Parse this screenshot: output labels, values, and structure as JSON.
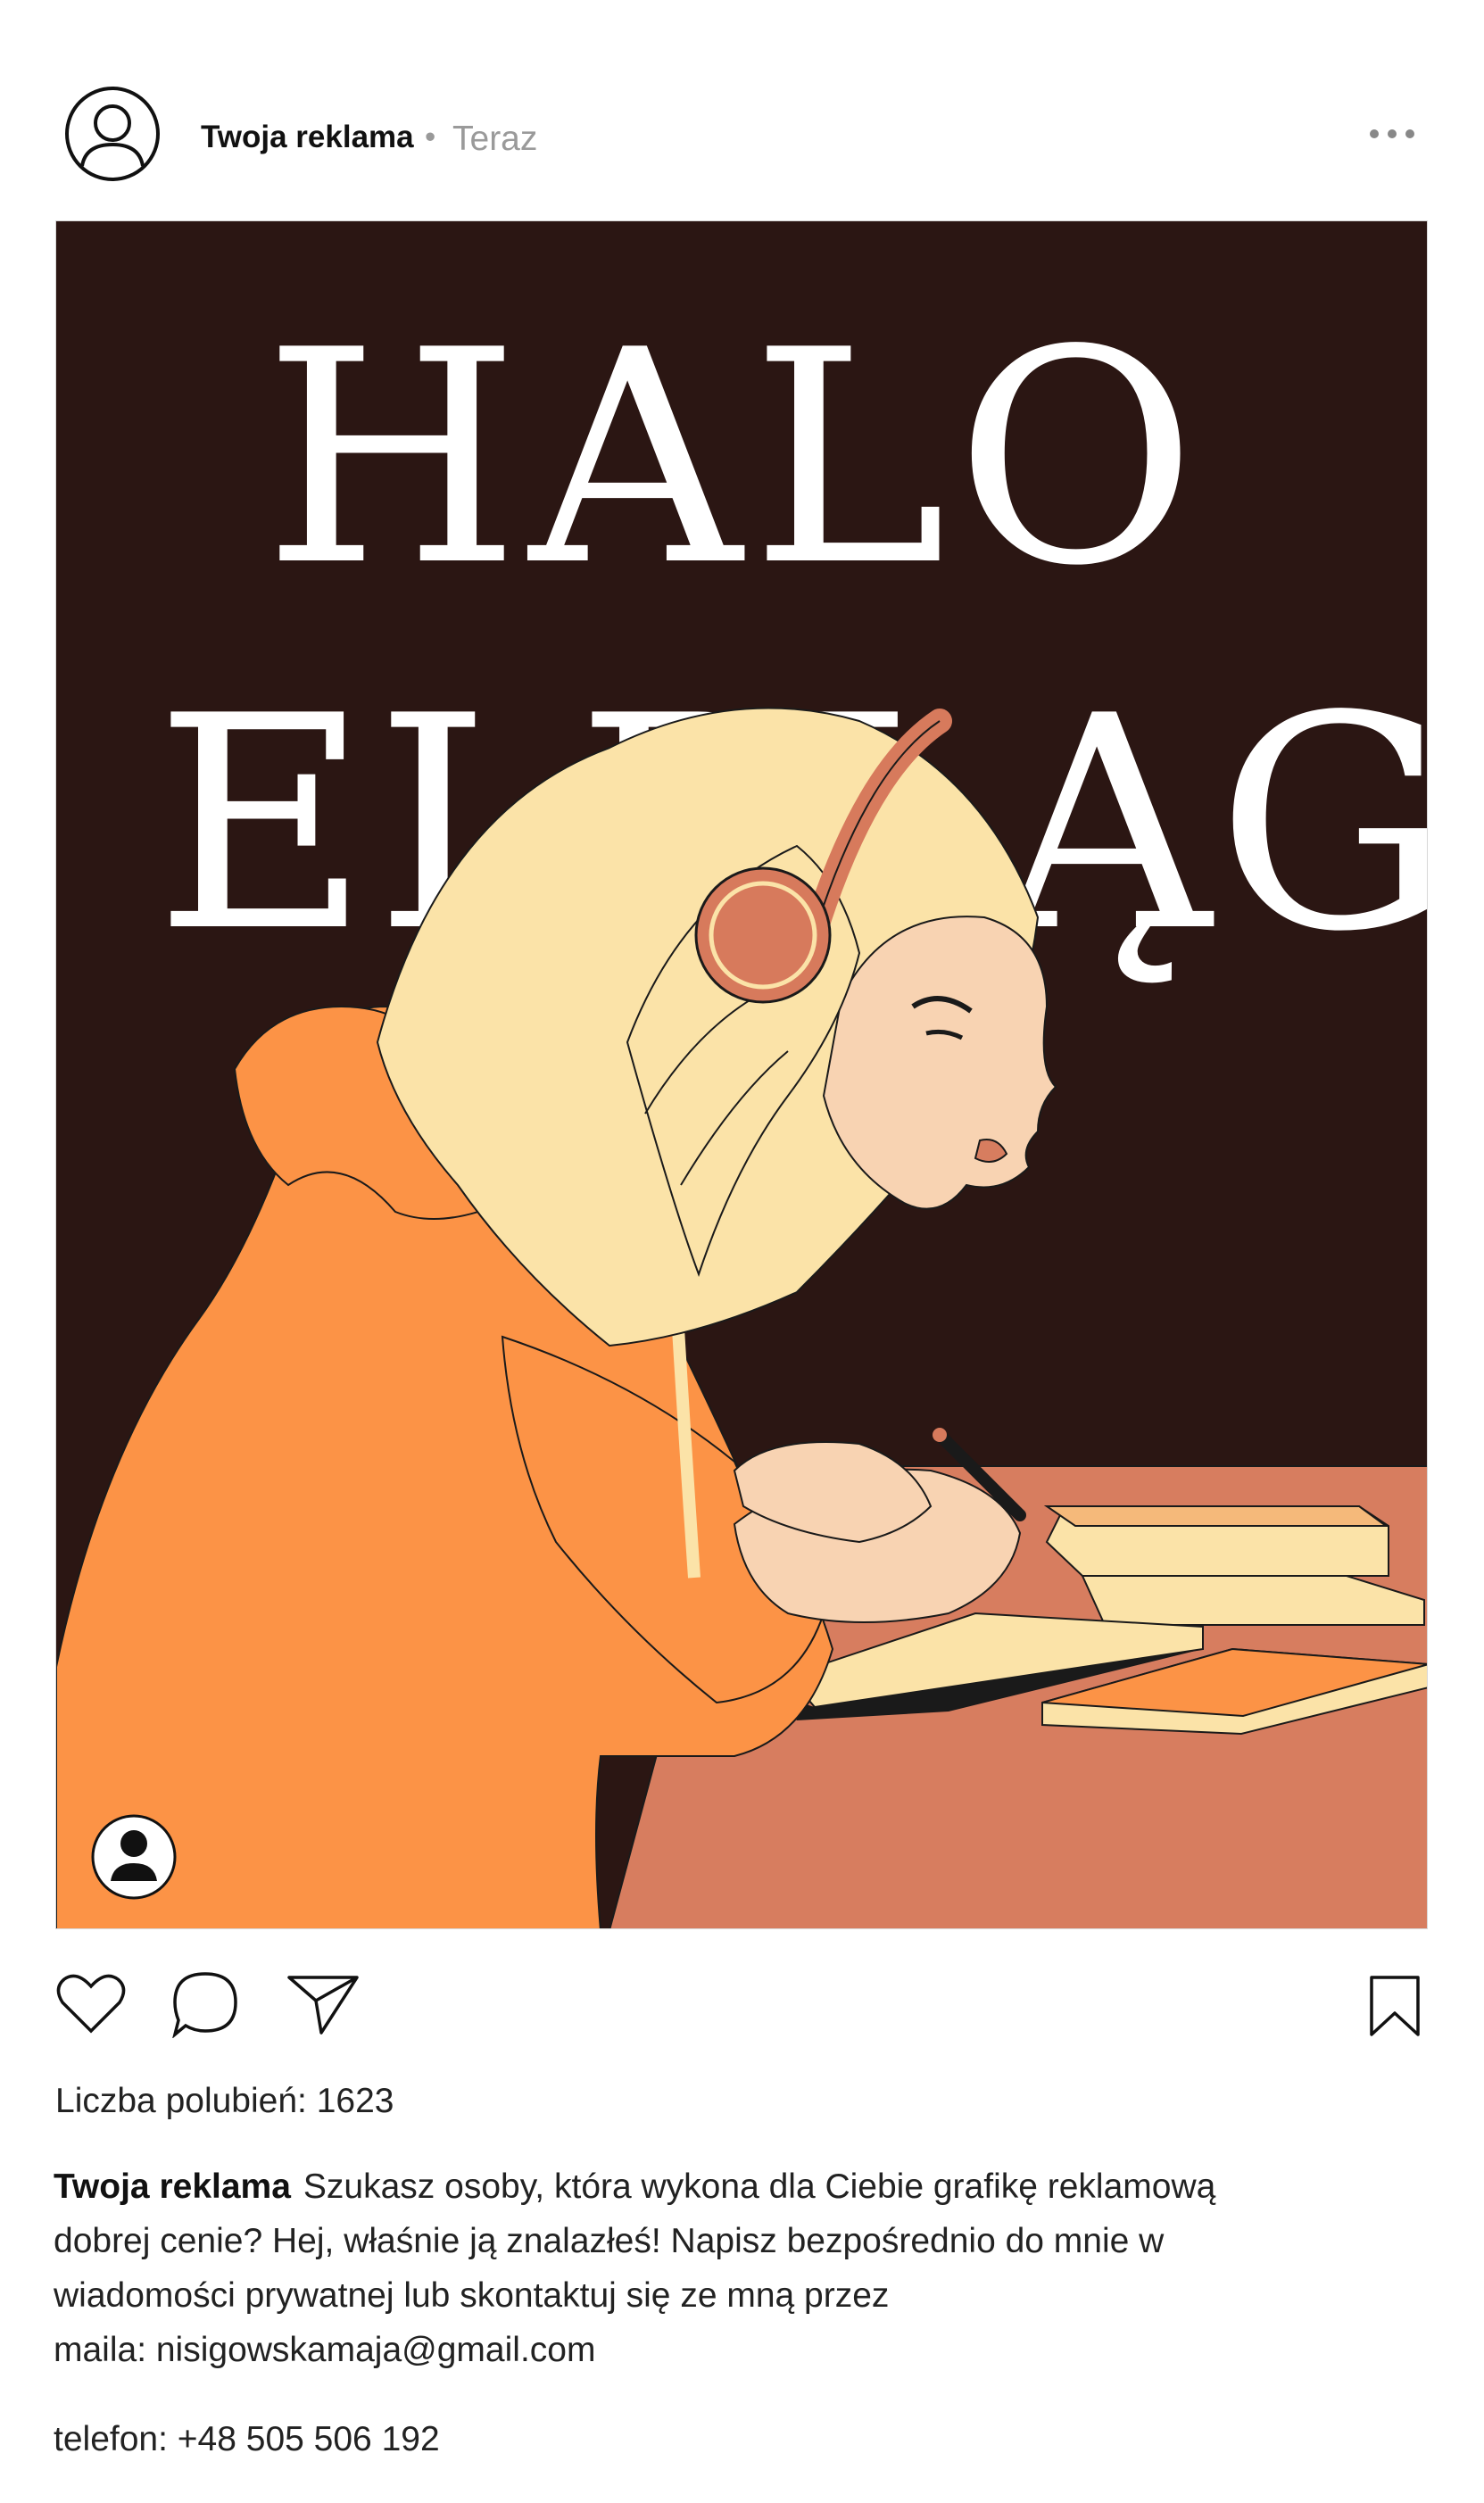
{
  "header": {
    "user": "Twoja reklama",
    "separator": "•",
    "time": "Teraz",
    "avatar_icon": "user-outline-icon",
    "more_icon": "more-horizontal-icon"
  },
  "post": {
    "headline_line1": "HALO",
    "headline_line2": "ELBLĄG",
    "illustration": "girl-with-headphones-writing",
    "tag_icon": "user-tag-icon",
    "colors": {
      "background": "#2b1613",
      "hoodie": "#fc9346",
      "desk": "#d77d5f",
      "hair": "#fbe3a8",
      "skin": "#f8d3b2",
      "headphones": "#d77a5c"
    }
  },
  "actions": {
    "like_icon": "heart-icon",
    "comment_icon": "comment-icon",
    "share_icon": "send-icon",
    "save_icon": "bookmark-icon"
  },
  "likes": {
    "label": "Liczba polubień: 1623"
  },
  "caption": {
    "author": "Twoja reklama",
    "line1": "Szukasz osoby, która wykona dla Ciebie grafikę reklamową",
    "line2": "dobrej cenie? Hej, właśnie ją znalazłeś! Napisz bezpośrednio do mnie w",
    "line3": "wiadomości prywatnej lub skontaktuj się ze mną przez",
    "line4": "maila: nisigowskamaja@gmail.com",
    "phone": "telefon: +48 505 506 192"
  }
}
